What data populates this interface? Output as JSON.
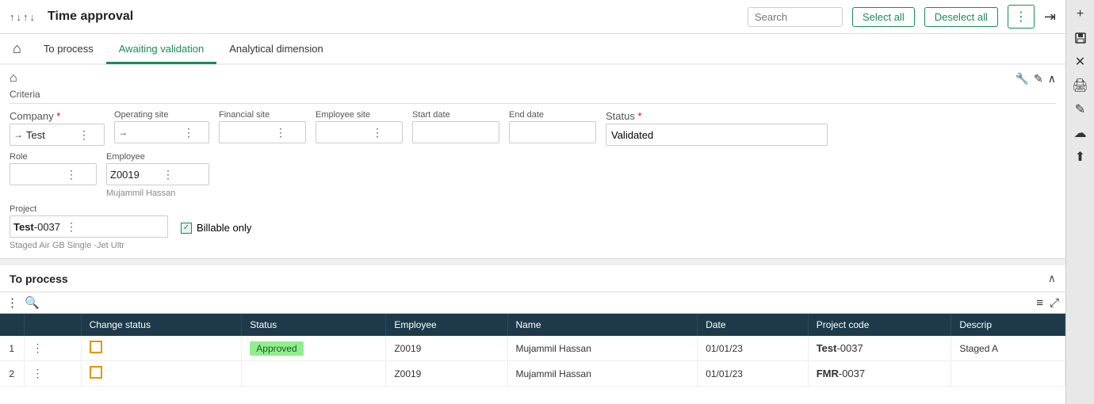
{
  "header": {
    "sort_icons": [
      "↑",
      "↓",
      "↑",
      "↓"
    ],
    "title": "Time approval",
    "search_placeholder": "Search",
    "select_all": "Select all",
    "deselect_all": "Deselect all",
    "dots_label": "⋮",
    "exit_icon": "→|"
  },
  "nav": {
    "home_icon": "⌂",
    "tabs": [
      {
        "label": "To process",
        "active": false
      },
      {
        "label": "Awaiting validation",
        "active": true
      },
      {
        "label": "Analytical dimension",
        "active": false
      }
    ]
  },
  "criteria": {
    "title": "Criteria",
    "home_icon": "⌂",
    "icons": [
      "✏",
      "✎",
      "∧"
    ],
    "fields": {
      "company": {
        "label": "Company",
        "required": true,
        "arrow": "→",
        "value": "Test"
      },
      "operating_site": {
        "label": "Operating site",
        "arrow": "→",
        "value": ""
      },
      "financial_site": {
        "label": "Financial site",
        "value": ""
      },
      "employee_site": {
        "label": "Employee site",
        "value": ""
      },
      "start_date": {
        "label": "Start date",
        "value": ""
      },
      "end_date": {
        "label": "End date",
        "value": ""
      },
      "status": {
        "label": "Status",
        "required": true,
        "value": "Validated"
      },
      "role": {
        "label": "Role",
        "value": ""
      },
      "employee": {
        "label": "Employee",
        "value": "Z0019",
        "sub": "Mujammil Hassan"
      },
      "project": {
        "label": "Project",
        "value": "Test",
        "value_suffix": "-0037",
        "sub": "Staged Air GB Single -Jet Ultr"
      },
      "billable_only": {
        "label": "Billable only",
        "checked": true
      }
    }
  },
  "to_process": {
    "title": "To process",
    "collapse_icon": "∧",
    "toolbar": {
      "dots_icon": "⋮",
      "search_icon": "🔍",
      "stack_icon": "≡",
      "expand_icon": "⤢"
    },
    "table": {
      "columns": [
        "Change status",
        "Status",
        "Employee",
        "Name",
        "Date",
        "Project code",
        "Descrip"
      ],
      "rows": [
        {
          "num": "1",
          "change_status": "checkbox",
          "status": "Approved",
          "employee": "Z0019",
          "name": "Mujammil Hassan",
          "date": "01/01/23",
          "project_code_bold": "Test",
          "project_code_suffix": "-0037",
          "description": "Staged A"
        },
        {
          "num": "2",
          "change_status": "checkbox",
          "status": "",
          "employee": "Z0019",
          "name": "Mujammil Hassan",
          "date": "01/01/23",
          "project_code_bold": "FMR",
          "project_code_suffix": "-0037",
          "description": ""
        }
      ]
    }
  },
  "sidebar": {
    "icons": [
      "+",
      "💾",
      "✕",
      "🖨",
      "✏",
      "☁",
      "⬆"
    ]
  }
}
